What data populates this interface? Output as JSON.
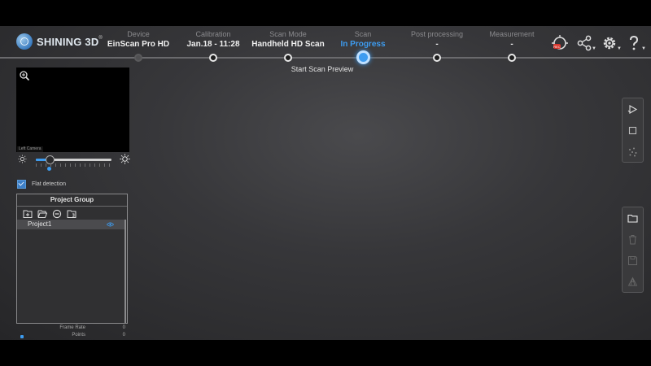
{
  "brand": {
    "name": "SHINING 3D",
    "reg": "®"
  },
  "steps": [
    {
      "label": "Device",
      "value": "EinScan Pro HD"
    },
    {
      "label": "Calibration",
      "value": "Jan.18 - 11:28"
    },
    {
      "label": "Scan Mode",
      "value": "Handheld HD Scan"
    },
    {
      "label": "Scan",
      "value": "In Progress"
    },
    {
      "label": "Post processing",
      "value": "-"
    },
    {
      "label": "Measurement",
      "value": "-"
    }
  ],
  "active_step_caption": "Start Scan Preview",
  "header_icons": [
    "record-icon",
    "share-icon",
    "settings-icon",
    "help-icon"
  ],
  "camera": {
    "label": "Left Camera"
  },
  "brightness": {
    "level_fraction": 0.18
  },
  "flat_detection": {
    "label": "Flat detection",
    "checked": true
  },
  "project_group": {
    "title": "Project Group",
    "tools": [
      "new-project-icon",
      "open-folder-icon",
      "remove-icon",
      "import-icon"
    ],
    "projects": [
      {
        "name": "Project1",
        "visible": true
      }
    ]
  },
  "stats": [
    {
      "name": "Frame Rate",
      "value": "0"
    },
    {
      "name": "Points",
      "value": "0"
    }
  ],
  "toolbar_scan": [
    "play-scan-icon",
    "stop-icon",
    "scatter-icon"
  ],
  "toolbar_file": [
    "folder-icon",
    "delete-icon",
    "save-icon",
    "mesh-icon"
  ],
  "colors": {
    "accent": "#3d9cf0",
    "background": "#37373a"
  }
}
